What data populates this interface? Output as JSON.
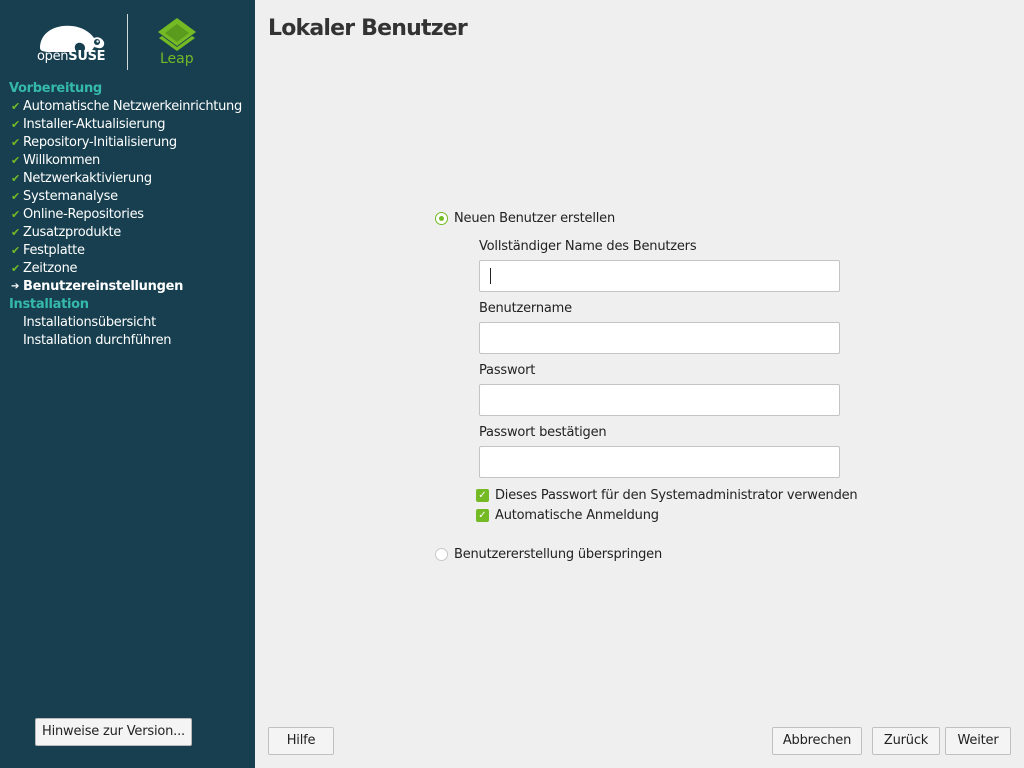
{
  "branding": {
    "opensuse_prefix": "open",
    "opensuse_suffix": "SUSE",
    "product": "Leap",
    "green": "#73ba25",
    "teal": "#35b9ab",
    "sidebar_bg": "#173f4f"
  },
  "sidebar": {
    "sections": [
      {
        "title": "Vorbereitung",
        "steps": [
          {
            "label": "Automatische Netzwerkeinrichtung",
            "state": "done"
          },
          {
            "label": "Installer-Aktualisierung",
            "state": "done"
          },
          {
            "label": "Repository-Initialisierung",
            "state": "done"
          },
          {
            "label": "Willkommen",
            "state": "done"
          },
          {
            "label": "Netzwerkaktivierung",
            "state": "done"
          },
          {
            "label": "Systemanalyse",
            "state": "done"
          },
          {
            "label": "Online-Repositories",
            "state": "done"
          },
          {
            "label": "Zusatzprodukte",
            "state": "done"
          },
          {
            "label": "Festplatte",
            "state": "done"
          },
          {
            "label": "Zeitzone",
            "state": "done"
          },
          {
            "label": "Benutzereinstellungen",
            "state": "current"
          }
        ]
      },
      {
        "title": "Installation",
        "steps": [
          {
            "label": "Installationsübersicht",
            "state": "pending"
          },
          {
            "label": "Installation durchführen",
            "state": "pending"
          }
        ]
      }
    ],
    "release_notes_button": "Hinweise zur Version..."
  },
  "main": {
    "title": "Lokaler Benutzer",
    "create_user_option": "Neuen Benutzer erstellen",
    "fields": {
      "full_name_label": "Vollständiger Name des Benutzers",
      "full_name_value": "",
      "username_label": "Benutzername",
      "username_value": "",
      "password_label": "Passwort",
      "password_value": "",
      "confirm_label": "Passwort bestätigen",
      "confirm_value": ""
    },
    "checkboxes": {
      "use_for_admin": "Dieses Passwort für den Systemadministrator verwenden",
      "autologin": "Automatische Anmeldung"
    },
    "skip_option": "Benutzererstellung überspringen"
  },
  "buttons": {
    "help": "Hilfe",
    "abort": "Abbrechen",
    "back": "Zurück",
    "next": "Weiter"
  }
}
